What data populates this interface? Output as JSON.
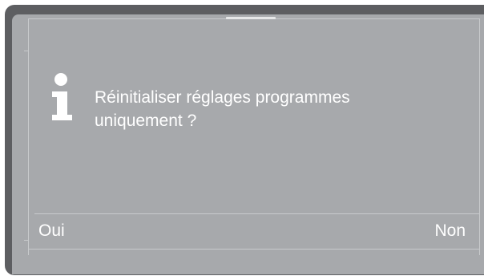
{
  "dialog": {
    "icon": "info-icon",
    "message_lines": [
      "Réinitialiser réglages programmes",
      "uniquement ?"
    ]
  },
  "actions": {
    "yes_label": "Oui",
    "no_label": "Non"
  },
  "colors": {
    "frame": "#5d5e61",
    "screen": "#a7a9ac",
    "text": "#ffffff",
    "guide": "#c8cacc"
  }
}
